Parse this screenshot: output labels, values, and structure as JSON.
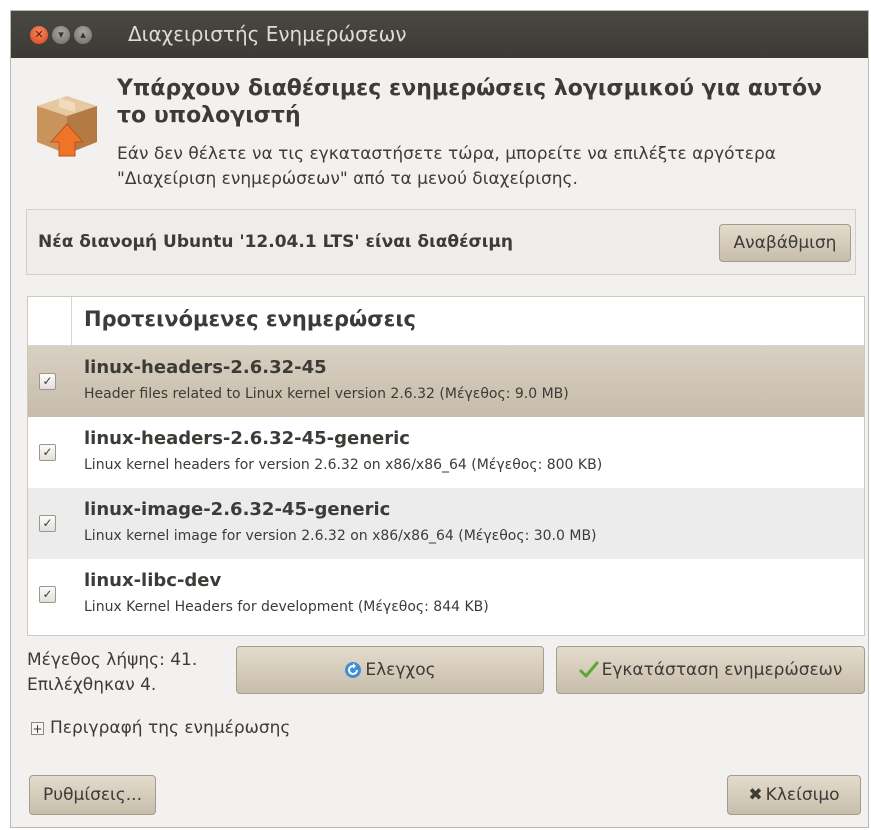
{
  "window": {
    "title": "Διαχειριστής Ενημερώσεων",
    "close_glyph": "✕",
    "minimize_glyph": "▾",
    "maximize_glyph": "▴"
  },
  "header": {
    "icon": "package-upgrade-icon",
    "title": "Υπάρχουν διαθέσιμες ενημερώσεις λογισμικού για αυτόν το υπολογιστή",
    "subtitle": "Εάν δεν θέλετε να τις εγκαταστήσετε τώρα, μπορείτε να επιλέξτε αργότερα \"Διαχείριση ενημερώσεων\" από τα μενού διαχείρισης."
  },
  "distribution": {
    "message": "Νέα διανομή Ubuntu '12.04.1 LTS' είναι διαθέσιμη",
    "upgrade_label": "Αναβάθμιση"
  },
  "updates": {
    "header": "Προτεινόμενες ενημερώσεις",
    "packages": [
      {
        "checked": true,
        "check_glyph": "✓",
        "name": "linux-headers-2.6.32-45",
        "description": "Header files related to Linux kernel version 2.6.32 (Μέγεθος: 9.0 MB)"
      },
      {
        "checked": true,
        "check_glyph": "✓",
        "name": "linux-headers-2.6.32-45-generic",
        "description": "Linux kernel headers for version 2.6.32 on x86/x86_64 (Μέγεθος: 800 KB)"
      },
      {
        "checked": true,
        "check_glyph": "✓",
        "name": "linux-image-2.6.32-45-generic",
        "description": "Linux kernel image for version 2.6.32 on x86/x86_64 (Μέγεθος: 30.0 MB)"
      },
      {
        "checked": true,
        "check_glyph": "✓",
        "name": "linux-libc-dev",
        "description": "Linux Kernel Headers for development (Μέγεθος: 844 KB)"
      }
    ]
  },
  "status": {
    "download_size": "Μέγεθος λήψης: 41.",
    "selected": "Επιλέχθηκαν 4."
  },
  "actions": {
    "check_label": "Ελεγχος",
    "install_label": "Εγκατάσταση ενημερώσεων",
    "description_expander": "Περιγραφή της ενημέρωσης",
    "expander_glyph": "+",
    "settings_label": "Ρυθμίσεις...",
    "close_label": "Κλείσιμο",
    "close_glyph": "✖"
  },
  "colors": {
    "titlebar": "#3c3b37",
    "window_bg": "#f2f1f0",
    "selected_row": "#cfc6b6",
    "button_bg": "#d6cdbd",
    "close_button": "#e05a2b"
  }
}
